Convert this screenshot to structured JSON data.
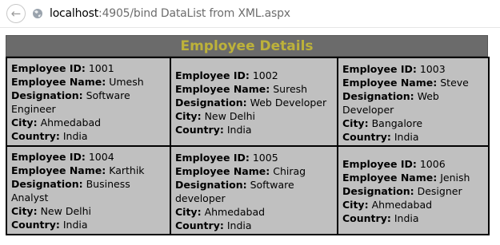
{
  "browser": {
    "url_host": "localhost",
    "url_rest": ":4905/bind DataList from XML.aspx"
  },
  "datalist": {
    "header": "Employee Details",
    "labels": {
      "id": "Employee ID:",
      "name": "Employee Name:",
      "designation": "Designation:",
      "city": "City:",
      "country": "Country:"
    },
    "employees": [
      {
        "id": "1001",
        "name": "Umesh",
        "designation": "Software Engineer",
        "city": "Ahmedabad",
        "country": "India"
      },
      {
        "id": "1002",
        "name": "Suresh",
        "designation": "Web Developer",
        "city": "New Delhi",
        "country": "India"
      },
      {
        "id": "1003",
        "name": "Steve",
        "designation": "Web Developer",
        "city": "Bangalore",
        "country": "India"
      },
      {
        "id": "1004",
        "name": "Karthik",
        "designation": "Business Analyst",
        "city": "New Delhi",
        "country": "India"
      },
      {
        "id": "1005",
        "name": "Chirag",
        "designation": "Software developer",
        "city": "Ahmedabad",
        "country": "India"
      },
      {
        "id": "1006",
        "name": "Jenish",
        "designation": "Designer",
        "city": "Ahmedabad",
        "country": "India"
      }
    ]
  },
  "colors": {
    "header_bg": "#6b6b6b",
    "header_text": "#bdb23a",
    "cell_bg": "#c0c0c0"
  }
}
